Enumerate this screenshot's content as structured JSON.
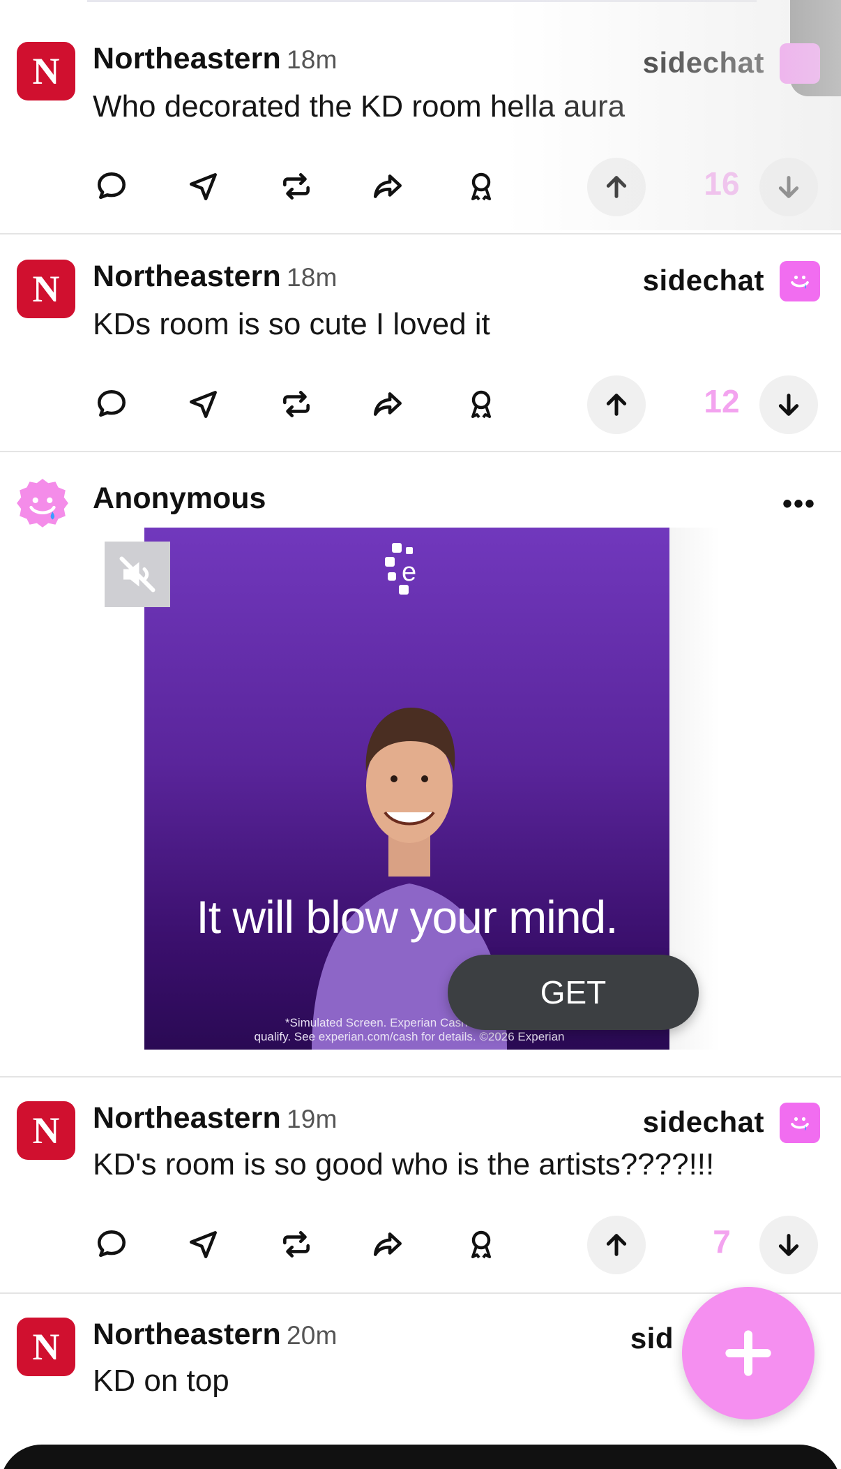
{
  "posts": [
    {
      "author": "Northeastern",
      "time": "18m",
      "text": "Who decorated the KD room hella aura",
      "brand": "sidechat",
      "score": "16"
    },
    {
      "author": "Northeastern",
      "time": "18m",
      "text": "KDs room is so cute I loved it",
      "brand": "sidechat",
      "score": "12"
    },
    {
      "author": "Northeastern",
      "time": "19m",
      "text": "KD's room is so good who is the artists????!!!",
      "brand": "sidechat",
      "score": "7"
    },
    {
      "author": "Northeastern",
      "time": "20m",
      "text": "KD on top",
      "brand": "sid",
      "score": ""
    }
  ],
  "avatar_letter": "N",
  "ad": {
    "author": "Anonymous",
    "more": "•••",
    "headline": "It will blow your mind.",
    "fine_print_1": "*Simulated Screen. Experian Cash™ is powere",
    "fine_print_2": "qualify. See experian.com/cash for details. ©2026 Experian",
    "cta": "GET",
    "logo_letter": "e"
  },
  "colors": {
    "accent_pink": "#f16df0",
    "score_pink": "#f3a3ef",
    "northeastern_red": "#d0102f",
    "ad_purple": "#6a30b0"
  },
  "icons": [
    "comment-icon",
    "send-icon",
    "repost-icon",
    "share-icon",
    "award-icon",
    "upvote-icon",
    "downvote-icon",
    "mute-icon",
    "plus-icon"
  ]
}
